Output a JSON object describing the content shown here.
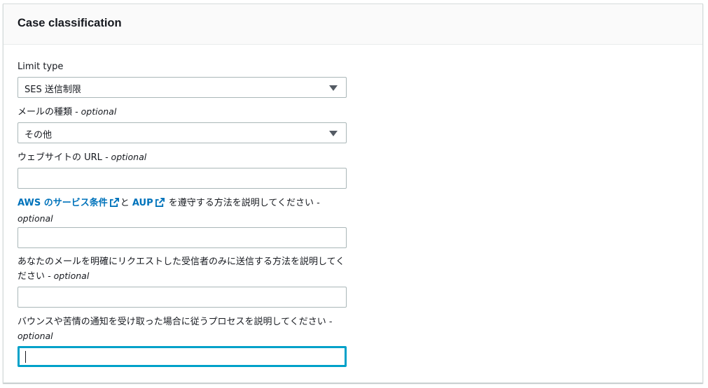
{
  "panel": {
    "title": "Case classification"
  },
  "fields": {
    "limit_type": {
      "label": "Limit type",
      "value": "SES 送信制限"
    },
    "mail_type": {
      "label": "メールの種類",
      "optional": "- optional",
      "value": "その他"
    },
    "website_url": {
      "label": "ウェブサイトの URL",
      "optional": "- optional",
      "value": ""
    },
    "aup": {
      "link1": "AWS のサービス条件",
      "conj": "と",
      "link2": "AUP",
      "label_rest": "を遵守する方法を説明してください",
      "optional": "- optional",
      "value": ""
    },
    "recipients": {
      "label": "あなたのメールを明確にリクエストした受信者のみに送信する方法を説明してください",
      "optional": "- optional",
      "value": ""
    },
    "bounce": {
      "label": "バウンスや苦情の通知を受け取った場合に従うプロセスを説明してください",
      "optional": "- optional",
      "value": ""
    }
  },
  "icons": {
    "select_caret": "caret-down-icon",
    "external_link": "external-link-icon"
  },
  "colors": {
    "link": "#0073bb",
    "focus_border": "#00a1c9",
    "header_bg": "#fafafa"
  }
}
